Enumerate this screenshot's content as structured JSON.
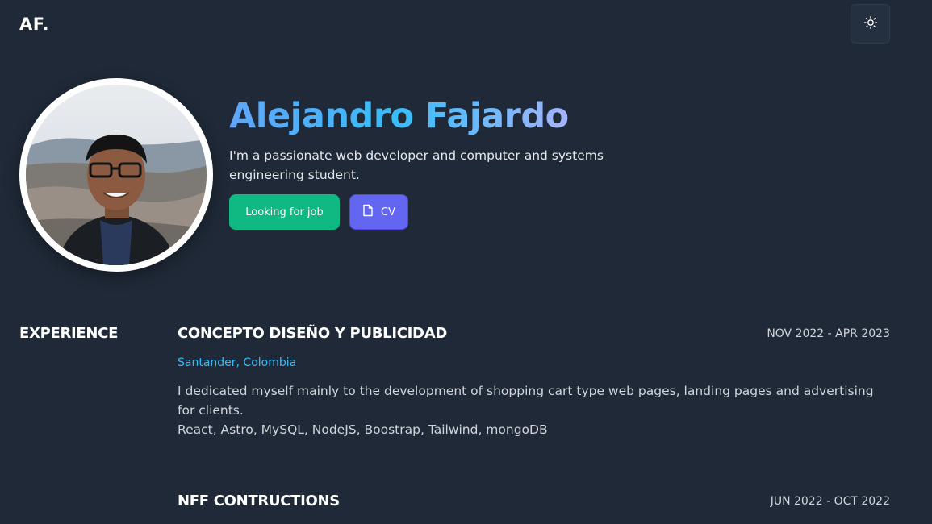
{
  "header": {
    "logo": "AF.",
    "theme_toggle_icon": "sun-icon"
  },
  "hero": {
    "name": "Alejandro Fajardo",
    "description": "I'm a passionate web developer and computer and systems engineering student.",
    "status_button": "Looking for job",
    "cv_button": "CV",
    "cv_icon": "document-icon"
  },
  "experience": {
    "section_title": "EXPERIENCE",
    "jobs": [
      {
        "company": "CONCEPTO DISEÑO Y PUBLICIDAD",
        "dates": "NOV 2022 - APR 2023",
        "location": "Santander, Colombia",
        "description": "I dedicated myself mainly to the development of shopping cart type web pages, landing pages and advertising for clients.",
        "tech": "React, Astro, MySQL, NodeJS, Boostrap, Tailwind, mongoDB"
      },
      {
        "company": "NFF CONTRUCTIONS",
        "dates": "JUN 2022 - OCT 2022"
      }
    ]
  },
  "colors": {
    "background": "#1f2937",
    "accent_green": "#10b981",
    "accent_indigo": "#6366f1",
    "link_blue": "#38bdf8"
  }
}
